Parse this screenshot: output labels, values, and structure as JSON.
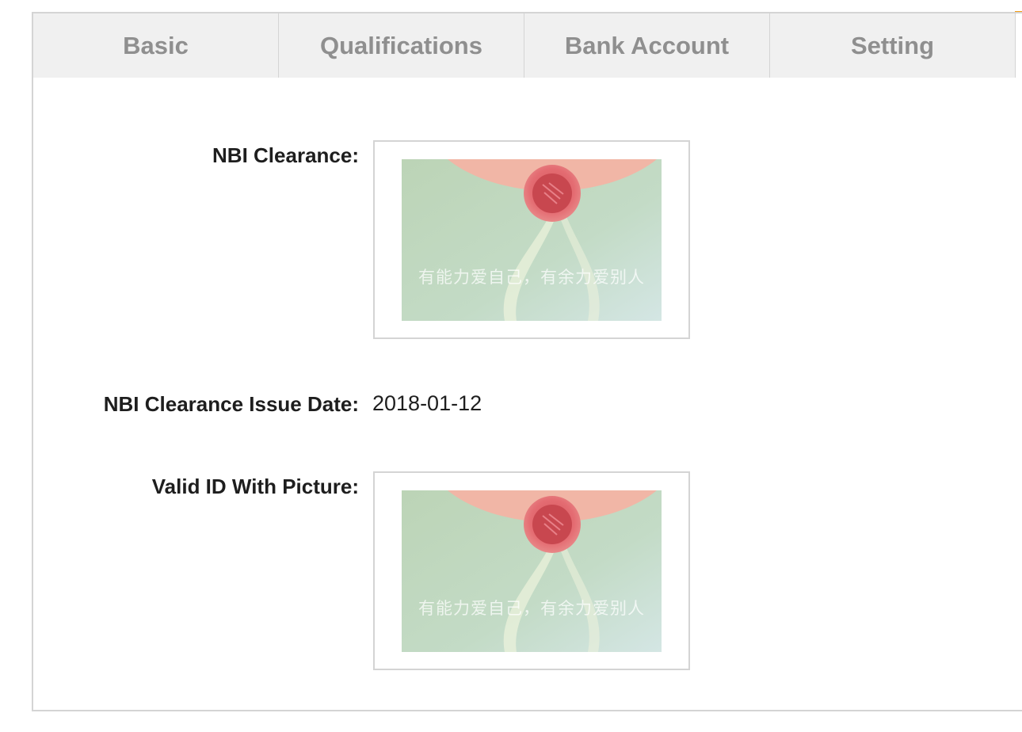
{
  "tabs": [
    {
      "label": "Basic"
    },
    {
      "label": "Qualifications"
    },
    {
      "label": "Bank Account"
    },
    {
      "label": "Setting"
    }
  ],
  "colors": {
    "accent": "#f39c12",
    "tab_background": "#f0f0f0",
    "tab_text": "#8f8f8f",
    "border": "#d4d4d4",
    "text": "#1e1e1e"
  },
  "fields": {
    "nbi_clearance": {
      "label": "NBI Clearance:",
      "image_caption": "有能力爱自己，有余力爱别人"
    },
    "nbi_issue_date": {
      "label": "NBI Clearance Issue Date:",
      "value": "2018-01-12"
    },
    "valid_id": {
      "label": "Valid ID With Picture:",
      "image_caption": "有能力爱自己，有余力爱别人"
    }
  }
}
